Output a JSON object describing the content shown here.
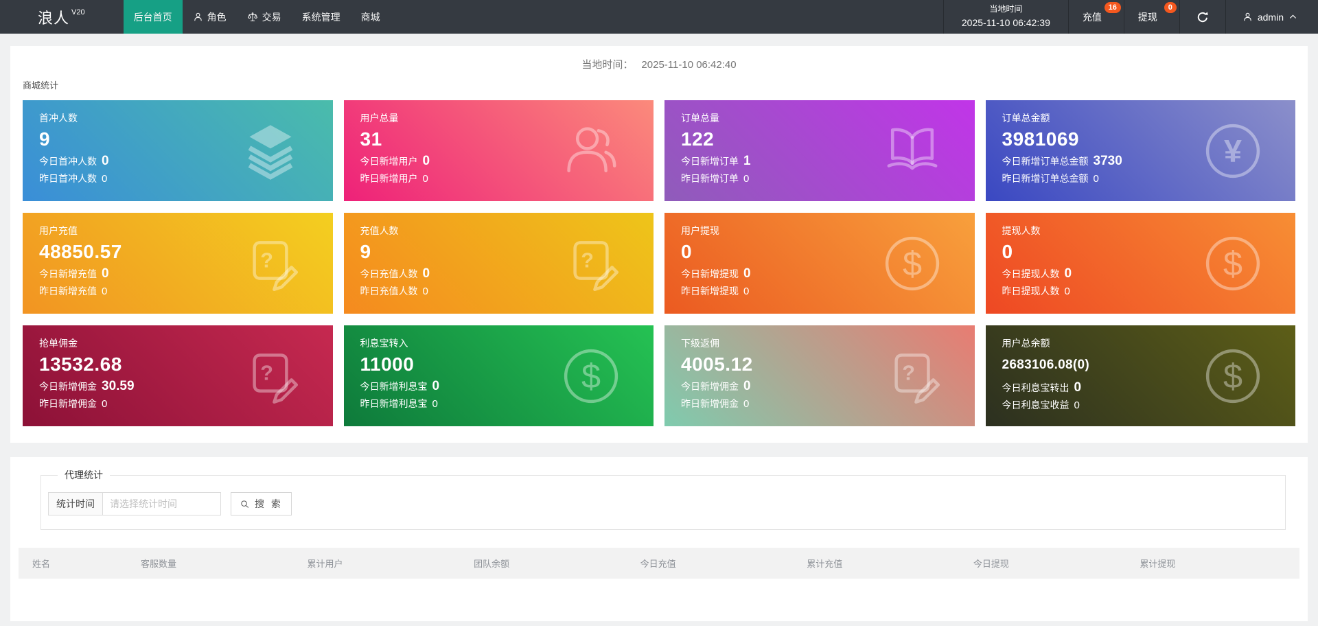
{
  "navbar": {
    "logo": "浪人",
    "logo_version": "V20",
    "menu": [
      {
        "id": "home",
        "label": "后台首页",
        "active": true
      },
      {
        "id": "roles",
        "label": "角色",
        "icon": "user-icon"
      },
      {
        "id": "trade",
        "label": "交易",
        "icon": "scale-icon"
      },
      {
        "id": "system",
        "label": "系统管理"
      },
      {
        "id": "mall",
        "label": "商城"
      }
    ],
    "local_time_label": "当地时间",
    "local_time_value": "2025-11-10 06:42:39",
    "recharge_label": "充值",
    "recharge_badge": "16",
    "withdraw_label": "提现",
    "withdraw_badge": "0",
    "username": "admin",
    "active_color": "#16a085",
    "badge_color": "#f4581f"
  },
  "main": {
    "time_label": "当地时间：",
    "time_value": "2025-11-10 06:42:40",
    "section_title": "商城统计",
    "cards": [
      {
        "id": "first-charge-users",
        "title": "首冲人数",
        "value": "9",
        "line1_label": "今日首冲人数",
        "line1_value": "0",
        "line2_label": "昨日首冲人数",
        "line2_value": "0",
        "icon": "layers-icon",
        "gradient": [
          "#3a8ed8",
          "#4abcab"
        ]
      },
      {
        "id": "total-users",
        "title": "用户总量",
        "value": "31",
        "line1_label": "今日新增用户",
        "line1_value": "0",
        "line2_label": "昨日新增用户",
        "line2_value": "0",
        "icon": "users-icon",
        "gradient": [
          "#ee2179",
          "#fb8a7b"
        ]
      },
      {
        "id": "total-orders",
        "title": "订单总量",
        "value": "122",
        "line1_label": "今日新增订单",
        "line1_value": "1",
        "line2_label": "昨日新增订单",
        "line2_value": "0",
        "icon": "book-icon",
        "gradient": [
          "#8f5cba",
          "#c135e8"
        ]
      },
      {
        "id": "order-total-amount",
        "title": "订单总金额",
        "value": "3981069",
        "line1_label": "今日新增订单总金额",
        "line1_value": "3730",
        "line2_label": "昨日新增订单总金额",
        "line2_value": "0",
        "icon": "yen-circle-icon",
        "gradient": [
          "#3a48c2",
          "#8b8fca"
        ]
      },
      {
        "id": "user-recharge",
        "title": "用户充值",
        "value": "48850.57",
        "line1_label": "今日新增充值",
        "line1_value": "0",
        "line2_label": "昨日新增充值",
        "line2_value": "0",
        "icon": "doc-edit-icon",
        "gradient": [
          "#f29422",
          "#f3cf20"
        ]
      },
      {
        "id": "recharge-users",
        "title": "充值人数",
        "value": "9",
        "line1_label": "今日充值人数",
        "line1_value": "0",
        "line2_label": "昨日充值人数",
        "line2_value": "0",
        "icon": "doc-edit-icon",
        "gradient": [
          "#f58a1f",
          "#eec51a"
        ]
      },
      {
        "id": "user-withdraw",
        "title": "用户提现",
        "value": "0",
        "line1_label": "今日新增提现",
        "line1_value": "0",
        "line2_label": "昨日新增提现",
        "line2_value": "0",
        "icon": "dollar-circle-icon",
        "gradient": [
          "#eb5a21",
          "#f8a03c"
        ]
      },
      {
        "id": "withdraw-users",
        "title": "提现人数",
        "value": "0",
        "line1_label": "今日提现人数",
        "line1_value": "0",
        "line2_label": "昨日提现人数",
        "line2_value": "0",
        "icon": "dollar-circle-icon",
        "gradient": [
          "#ee4823",
          "#f78e34"
        ]
      },
      {
        "id": "grab-commission",
        "title": "抢单佣金",
        "value": "13532.68",
        "line1_label": "今日新增佣金",
        "line1_value": "30.59",
        "line2_label": "昨日新增佣金",
        "line2_value": "0",
        "icon": "doc-edit-icon",
        "gradient": [
          "#8c1137",
          "#c62950"
        ]
      },
      {
        "id": "interest-transfer-in",
        "title": "利息宝转入",
        "value": "11000",
        "line1_label": "今日新增利息宝",
        "line1_value": "0",
        "line2_label": "昨日新增利息宝",
        "line2_value": "0",
        "icon": "dollar-circle-icon",
        "gradient": [
          "#0e7a3b",
          "#25c253"
        ]
      },
      {
        "id": "sub-rebate",
        "title": "下级返佣",
        "value": "4005.12",
        "line1_label": "今日新增佣金",
        "line1_value": "0",
        "line2_label": "昨日新增佣金",
        "line2_value": "0",
        "icon": "doc-edit-icon",
        "gradient": [
          "#7fcbae",
          "#e87c72"
        ]
      },
      {
        "id": "user-total-balance",
        "title": "用户总余额",
        "value": "2683106.08(0)",
        "line1_label": "今日利息宝转出",
        "line1_value": "0",
        "line2_label": "今日利息宝收益",
        "line2_value": "0",
        "icon": "dollar-circle-icon",
        "gradient": [
          "#2c3020",
          "#5d5e17"
        ]
      }
    ]
  },
  "agent": {
    "legend": "代理统计",
    "time_field_label": "统计时间",
    "time_placeholder": "请选择统计时间",
    "search_label": "搜 索",
    "table_headers": [
      "姓名",
      "客服数量",
      "累计用户",
      "团队余额",
      "今日充值",
      "累计充值",
      "今日提现",
      "累计提现"
    ]
  }
}
